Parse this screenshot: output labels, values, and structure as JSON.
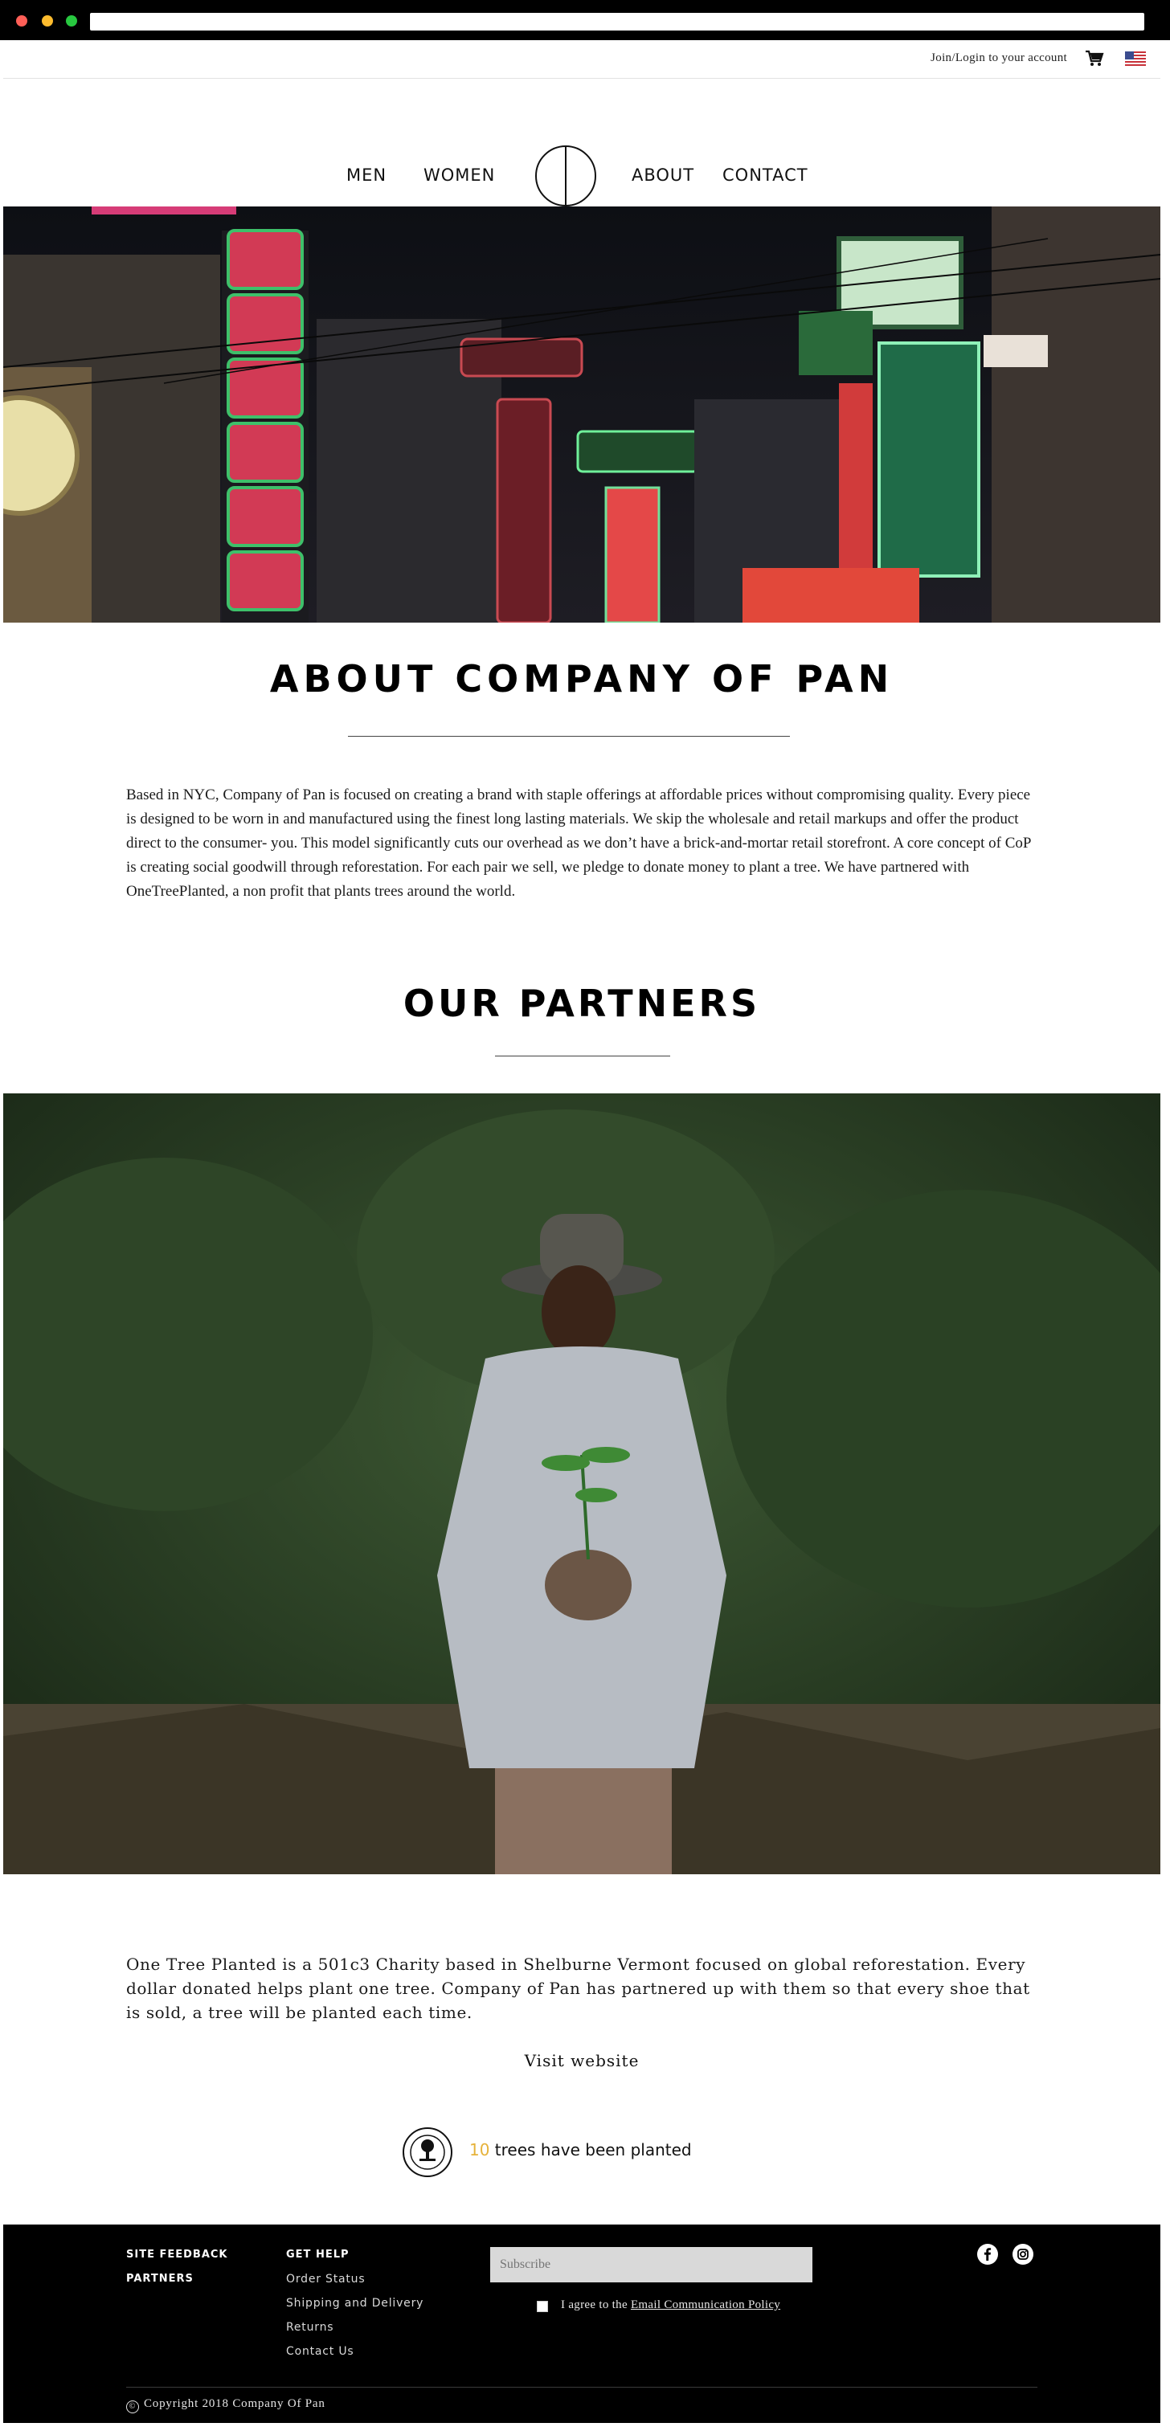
{
  "header": {
    "account_link": "Join/Login to your account",
    "cart_icon": "shopping-cart-icon",
    "flag_icon": "us-flag-icon"
  },
  "nav": {
    "items": [
      {
        "label": "MEN"
      },
      {
        "label": "WOMEN"
      },
      {
        "label": "ABOUT"
      },
      {
        "label": "CONTACT"
      }
    ],
    "logo_icon": "company-of-pan-logo-icon"
  },
  "about": {
    "title": "ABOUT COMPANY OF PAN",
    "body": "Based in NYC, Company of Pan is focused on creating a brand with staple offerings at affordable prices without compromising quality. Every piece is designed to be worn in and manufactured using the finest long lasting materials. We skip the wholesale and retail markups and offer the product direct to the consumer- you. This model significantly cuts our overhead as we don’t have a brick-and-mortar retail storefront. A core concept of CoP is creating social goodwill through reforestation. For each pair we sell, we pledge to donate money to plant a tree. We have partnered with OneTreePlanted, a non profit that plants trees around the world."
  },
  "partners": {
    "title": "OUR PARTNERS",
    "description": "One Tree Planted is a 501c3 Charity based in Shelburne Vermont focused on global reforestation. Every dollar donated helps plant one tree. Company of Pan has partnered up with them so that every shoe that is sold, a tree will be planted each time.",
    "visit_link": "Visit website",
    "trees_count": "10",
    "trees_text": " trees have been planted",
    "badge_icon": "one-tree-planted-badge-icon"
  },
  "footer": {
    "col1": [
      "SITE FEEDBACK",
      "PARTNERS"
    ],
    "col2_head": "GET HELP",
    "col2_links": [
      "Order Status",
      "Shipping and Delivery",
      "Returns",
      "Contact Us"
    ],
    "subscribe_placeholder": "Subscribe",
    "agree_prefix": "I agree to the ",
    "agree_link": "Email Communication Policy",
    "social": [
      "facebook-icon",
      "instagram-icon"
    ],
    "copyright": "Copyright 2018 Company Of Pan",
    "copyright_icon": "©"
  },
  "colors": {
    "accent_count": "#e6b23a",
    "footer_bg": "#000000"
  }
}
